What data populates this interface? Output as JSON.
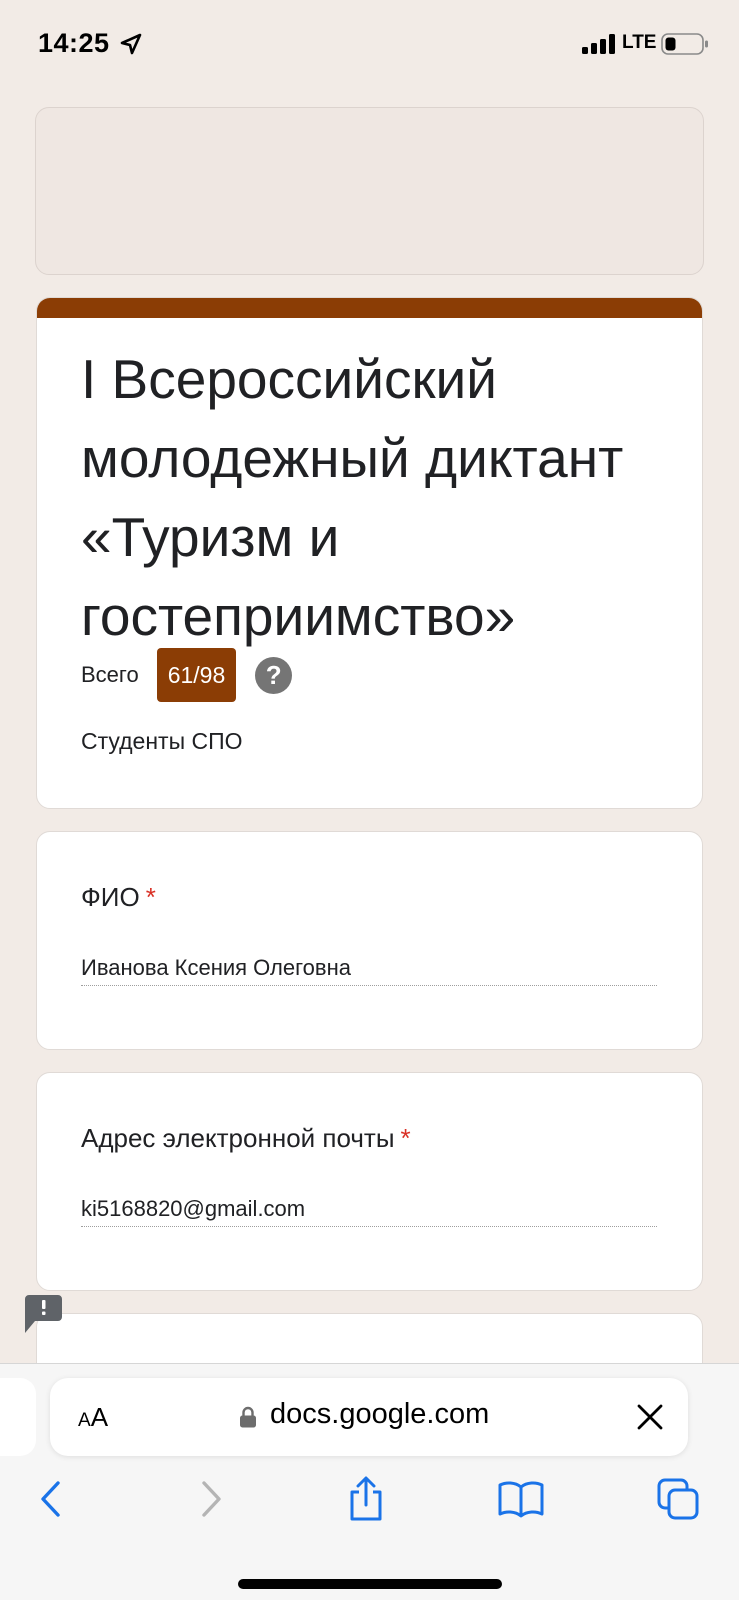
{
  "status_bar": {
    "time": "14:25",
    "network": "LTE"
  },
  "form": {
    "title": "I Всероссийский молодежный диктант «Туризм и гостеприимство»",
    "score_label": "Всего",
    "score_value": "61/98",
    "help_icon": "?",
    "description": "Студенты СПО",
    "accent_color": "#8b3d05"
  },
  "questions": [
    {
      "label": "ФИО",
      "required_mark": "*",
      "value": "Иванова Ксения Олеговна"
    },
    {
      "label": "Адрес электронной почты",
      "required_mark": "*",
      "value": "ki5168820@gmail.com"
    }
  ],
  "browser": {
    "text_size_small": "A",
    "text_size_large": "A",
    "url": "docs.google.com",
    "icons": [
      "back-icon",
      "forward-icon",
      "share-icon",
      "bookmarks-icon",
      "tabs-icon"
    ]
  }
}
